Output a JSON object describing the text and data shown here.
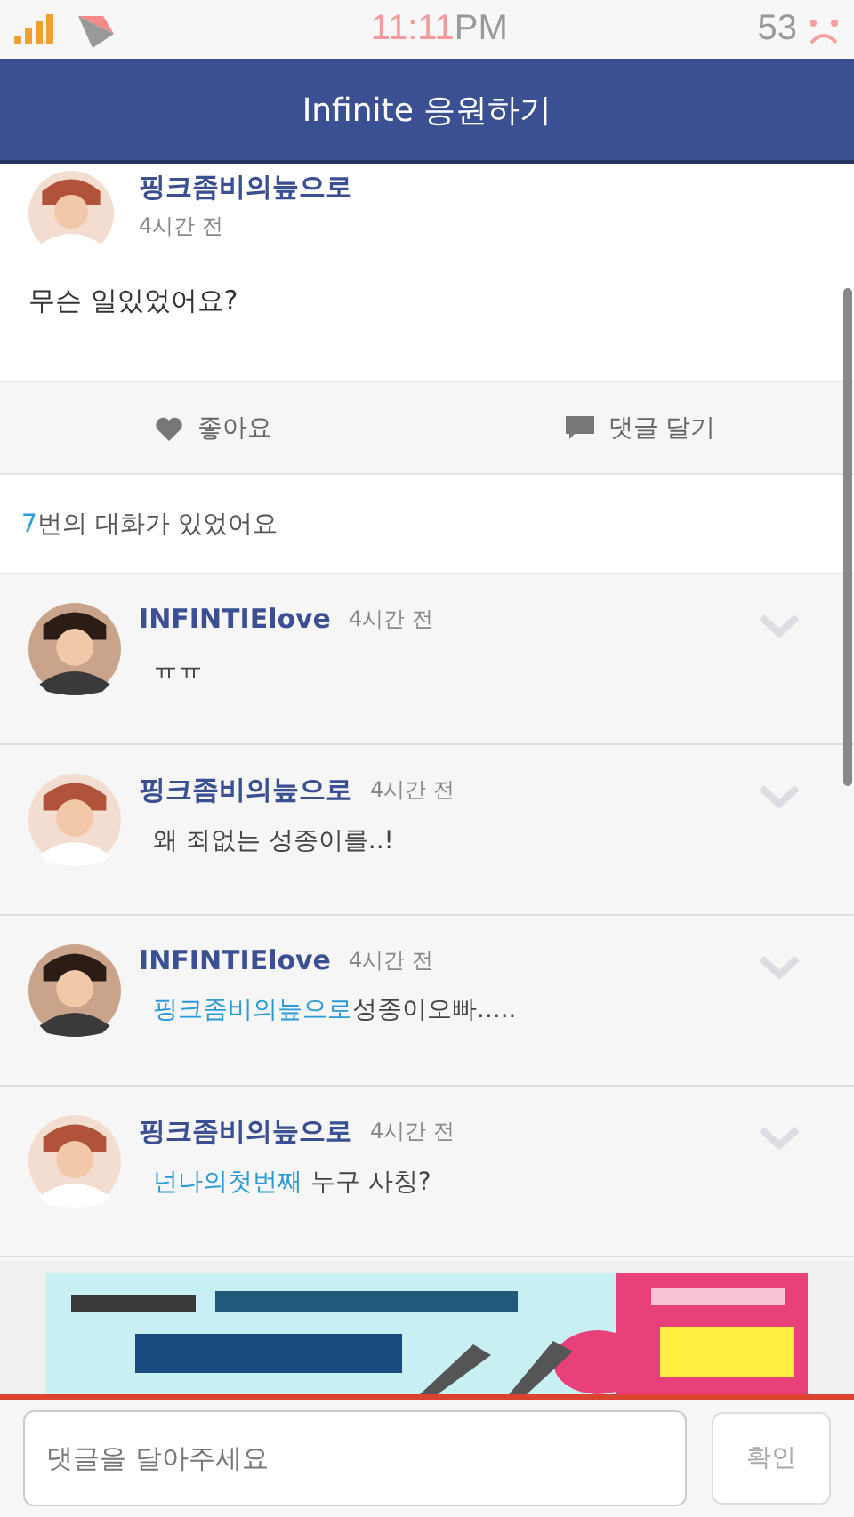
{
  "status_bar": {
    "time": "11:11",
    "meridiem": "PM",
    "battery": "53"
  },
  "header": {
    "title": "Infinite 응원하기"
  },
  "post": {
    "author": "핑크좀비의늪으로",
    "time": "4시간 전",
    "text": "무슨 일있었어요?"
  },
  "actions": [
    {
      "kind": "like",
      "label": "좋아요"
    },
    {
      "kind": "comment",
      "label": "댓글 달기"
    }
  ],
  "conversation_count": {
    "count": "7",
    "label": "번의 대화가 있었어요"
  },
  "comments": [
    {
      "author": "INFINTIElove",
      "time": "4시간 전",
      "text": "ㅠㅠ"
    },
    {
      "author": "핑크좀비의늪으로",
      "time": "4시간 전",
      "text": "왜 죄없는 성종이를..!"
    },
    {
      "author": "INFINTIElove",
      "time": "4시간 전",
      "mention": "핑크좀비의늪으로",
      "text": "성종이오빠....."
    },
    {
      "author": "핑크좀비의늪으로",
      "time": "4시간 전",
      "mention": "넌나의첫번째",
      "text": " 누구 사칭?"
    }
  ],
  "comment_input": {
    "placeholder": "댓글을 달아주세요",
    "button": "확인"
  }
}
